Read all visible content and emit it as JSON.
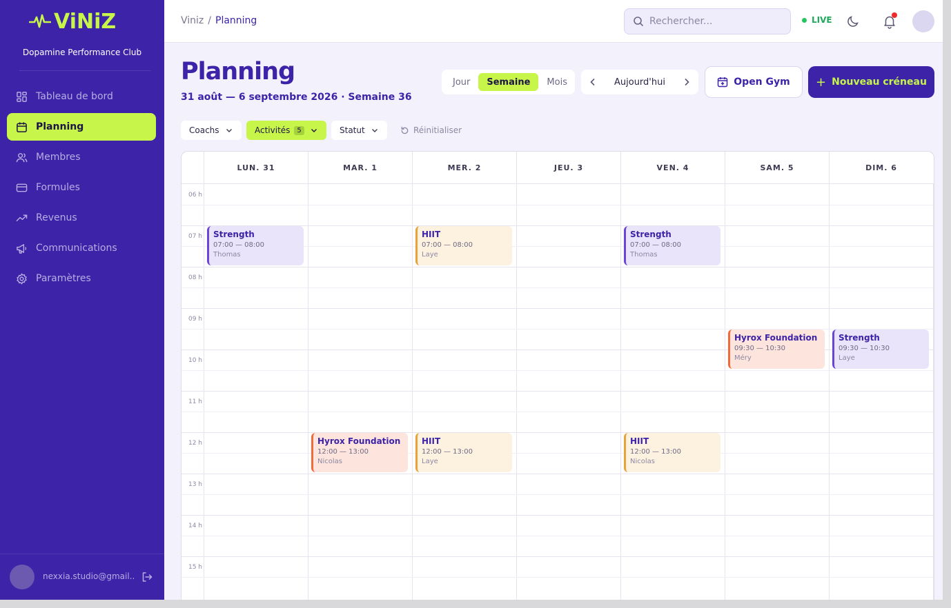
{
  "brand": {
    "logo_text": "ViNiZ",
    "club_name": "Dopamine Performance Club"
  },
  "sidebar": {
    "items": [
      {
        "label": "Tableau de bord",
        "icon": "dashboard-icon"
      },
      {
        "label": "Planning",
        "icon": "calendar-icon",
        "active": true
      },
      {
        "label": "Membres",
        "icon": "users-icon"
      },
      {
        "label": "Formules",
        "icon": "card-icon"
      },
      {
        "label": "Revenus",
        "icon": "trending-up-icon"
      },
      {
        "label": "Communications",
        "icon": "megaphone-icon"
      },
      {
        "label": "Paramètres",
        "icon": "settings-icon"
      }
    ],
    "user_email": "nexxia.studio@gmail...."
  },
  "topbar": {
    "breadcrumb": [
      "Viniz",
      "Planning"
    ],
    "search_placeholder": "Rechercher...",
    "live_label": "LIVE"
  },
  "page": {
    "title": "Planning",
    "subtitle": "31 août — 6 septembre 2026 · Semaine 36"
  },
  "view_switch": {
    "options": [
      "Jour",
      "Semaine",
      "Mois"
    ],
    "selected": "Semaine"
  },
  "date_nav": {
    "today_label": "Aujourd'hui"
  },
  "actions": {
    "open_gym": "Open Gym",
    "new_slot": "Nouveau créneau"
  },
  "filters": {
    "coaches": "Coachs",
    "activities": "Activités",
    "activities_count": "5",
    "status": "Statut",
    "reset": "Réinitialiser"
  },
  "calendar": {
    "days": [
      "LUN. 31",
      "MAR. 1",
      "MER. 2",
      "JEU. 3",
      "VEN. 4",
      "SAM. 5",
      "DIM. 6"
    ],
    "hours": [
      "06 h",
      "07 h",
      "08 h",
      "09 h",
      "10 h",
      "11 h",
      "12 h",
      "13 h",
      "14 h",
      "15 h"
    ],
    "events": [
      {
        "day": 0,
        "start": "07:00",
        "end": "08:00",
        "title": "Strength",
        "time": "07:00 — 08:00",
        "coach": "Thomas",
        "kind": "strength"
      },
      {
        "day": 2,
        "start": "07:00",
        "end": "08:00",
        "title": "HIIT",
        "time": "07:00 — 08:00",
        "coach": "Laye",
        "kind": "hiit"
      },
      {
        "day": 4,
        "start": "07:00",
        "end": "08:00",
        "title": "Strength",
        "time": "07:00 — 08:00",
        "coach": "Thomas",
        "kind": "strength"
      },
      {
        "day": 5,
        "start": "09:30",
        "end": "10:30",
        "title": "Hyrox Foundation",
        "time": "09:30 — 10:30",
        "coach": "Méry",
        "kind": "hyrox"
      },
      {
        "day": 6,
        "start": "09:30",
        "end": "10:30",
        "title": "Strength",
        "time": "09:30 — 10:30",
        "coach": "Laye",
        "kind": "strength"
      },
      {
        "day": 1,
        "start": "12:00",
        "end": "13:00",
        "title": "Hyrox Foundation",
        "time": "12:00 — 13:00",
        "coach": "Nicolas",
        "kind": "hyrox"
      },
      {
        "day": 2,
        "start": "12:00",
        "end": "13:00",
        "title": "HIIT",
        "time": "12:00 — 13:00",
        "coach": "Laye",
        "kind": "hiit"
      },
      {
        "day": 4,
        "start": "12:00",
        "end": "13:00",
        "title": "HIIT",
        "time": "12:00 — 13:00",
        "coach": "Nicolas",
        "kind": "hiit"
      }
    ]
  },
  "colors": {
    "brand": "#3c23a8",
    "accent": "#c7f54a",
    "strength_bg": "#e9e4fa",
    "strength_border": "#6a45d6",
    "hiit_bg": "#fdf2df",
    "hiit_border": "#e8a23a",
    "hyrox_bg": "#fde4dc",
    "hyrox_border": "#f06a3a"
  }
}
